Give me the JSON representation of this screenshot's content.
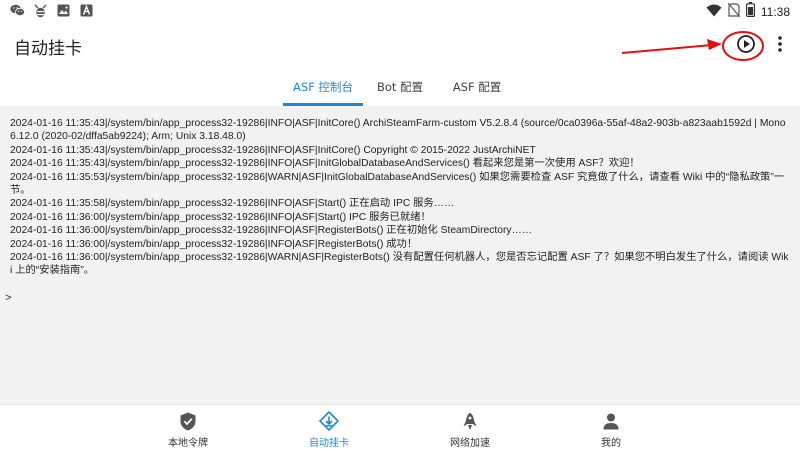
{
  "status_bar": {
    "time": "11:38",
    "left_icons": [
      "wechat-icon",
      "bug-icon",
      "photo-icon",
      "a-letter-icon"
    ],
    "right_icons": [
      "wifi-icon",
      "no-sim-icon",
      "battery-icon"
    ]
  },
  "app_bar": {
    "title": "自动挂卡",
    "actions": [
      "play-circle-icon",
      "more-vert-icon"
    ]
  },
  "tabs": [
    {
      "label": "ASF 控制台",
      "active": true
    },
    {
      "label": "Bot 配置",
      "active": false
    },
    {
      "label": "ASF 配置",
      "active": false
    }
  ],
  "console": {
    "lines": [
      "2024-01-16 11:35:43|/system/bin/app_process32-19286|INFO|ASF|InitCore() ArchiSteamFarm-custom V5.2.8.4 (source/0ca0396a-55af-48a2-903b-a823aab1592d | Mono 6.12.0 (2020-02/dffa5ab9224); Arm; Unix 3.18.48.0)",
      "2024-01-16 11:35:43|/system/bin/app_process32-19286|INFO|ASF|InitCore() Copyright © 2015-2022 JustArchiNET",
      "2024-01-16 11:35:43|/system/bin/app_process32-19286|INFO|ASF|InitGlobalDatabaseAndServices() 看起来您是第一次使用 ASF？欢迎！",
      "2024-01-16 11:35:53|/system/bin/app_process32-19286|WARN|ASF|InitGlobalDatabaseAndServices() 如果您需要检查 ASF 究竟做了什么，请查看 Wiki 中的“隐私政策”一节。",
      "2024-01-16 11:35:58|/system/bin/app_process32-19286|INFO|ASF|Start() 正在启动 IPC 服务……",
      "2024-01-16 11:36:00|/system/bin/app_process32-19286|INFO|ASF|Start() IPC 服务已就绪！",
      "2024-01-16 11:36:00|/system/bin/app_process32-19286|INFO|ASF|RegisterBots() 正在初始化 SteamDirectory……",
      "2024-01-16 11:36:00|/system/bin/app_process32-19286|INFO|ASF|RegisterBots() 成功！",
      "2024-01-16 11:36:00|/system/bin/app_process32-19286|WARN|ASF|RegisterBots() 没有配置任何机器人，您是否忘记配置 ASF 了？如果您不明白发生了什么，请阅读 Wiki 上的“安装指南”。"
    ],
    "prompt": ">"
  },
  "bottom_nav": [
    {
      "label": "本地令牌",
      "icon": "shield-check-icon",
      "active": false
    },
    {
      "label": "自动挂卡",
      "icon": "diamond-download-icon",
      "active": true
    },
    {
      "label": "网络加速",
      "icon": "rocket-icon",
      "active": false
    },
    {
      "label": "我的",
      "icon": "person-icon",
      "active": false
    }
  ],
  "colors": {
    "accent": "#1e88d5",
    "console_bg": "#f2f2f2",
    "annotation": "#e01010"
  }
}
